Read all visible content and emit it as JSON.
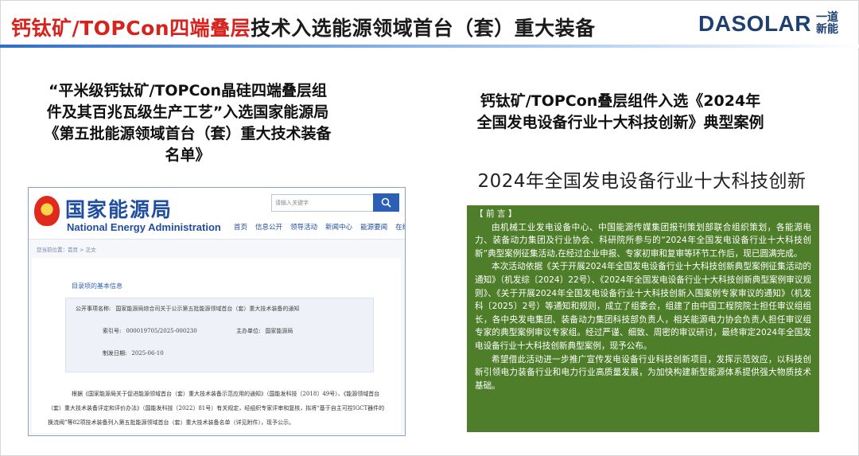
{
  "header": {
    "title_highlight": "钙钛矿/TOPCon四端叠层",
    "title_rest": "技术入选能源领域首台（套）重大装备",
    "logo_text": "DASOLAR",
    "logo_cn_line1": "一道",
    "logo_cn_line2": "新能"
  },
  "left_caption": "“平米级钙钛矿/TOPCon晶硅四端叠层组件及其百兆瓦级生产工艺”入选国家能源局《第五批能源领域首台（套）重大技术装备名单》",
  "right_caption": "钙钛矿/TOPCon叠层组件入选《2024年全国发电设备行业十大科技创新》典型案例",
  "nea_site": {
    "name_cn": "国家能源局",
    "name_en": "National Energy Administration",
    "search_placeholder": "请输入关键字",
    "search_icon": "search-icon",
    "nav": [
      "首页",
      "信息公开",
      "领导活动",
      "新闻中心",
      "能源要闻",
      "在线办事"
    ],
    "breadcrumb": "您当前位置：首页 > 正文",
    "info_title": "目录项的基本信息",
    "info_rows": {
      "public_item_label": "公开事项名称:",
      "public_item_value": "国家能源局综合司关于公示第五批能源领域首台（套）重大技术装备的通知",
      "index_label": "索引号:",
      "index_value": "000019705/2025-000230",
      "issuer_label": "主办单位:",
      "issuer_value": "国家能源局",
      "date_label": "制发日期:",
      "date_value": "2025-06-10"
    },
    "paragraph": "根据《国家能源局关于促进能源领域首台（套）重大技术装备示范应用的通知》（国能发科技〔2018〕49号）、《能源领域首台（套）重大技术装备评定和评价办法》（国能发科技〔2022〕81号）有关规定，经组织专家评审和复核，拟将“基于自主可控IGCT器件的换流阀”等82项技术装备列入第五批能源领域首台（套）重大技术装备名单（详见附件），现予公示。"
  },
  "award": {
    "heading": "2024年全国发电设备行业十大科技创新",
    "notice_label": "【 前 言 】",
    "paragraphs": [
      "由机械工业发电设备中心、中国能源传媒集团报刊策划部联合组织策划，各能源电力、装备动力集团及行业协会、科研院所参与的“2024年全国发电设备行业十大科技创新”典型案例征集活动,在经过企业申报、专家初审和复审等环节工作后，现已圆满完成。",
      "本次活动依据《关于开展2024年全国发电设备行业十大科技创新典型案例征集活动的通知》（机发综〔2024〕22号）、《2024年全国发电设备行业十大科技创新典型案例审议规则》、《关于开展2024年全国发电设备行业十大科技创新入围案例专家审议的通知》（机发科〔2025〕2号）等通知和规则，成立了组委会，组建了由中国工程院院士担任审议组组长，各中央发电集团、装备动力集团科技部负责人，相关能源电力协会负责人担任审议组专家的典型案例审议专家组。经过严谨、细致、周密的审议研讨，最终审定2024年全国发电设备行业十大科技创新典型案例，现予公布。",
      "希望借此活动进一步推广宣传发电设备行业科技创新项目，发挥示范效应，以科技创新引领电力装备行业和电力行业高质量发展，为加快构建新型能源体系提供强大物质技术基础。"
    ]
  },
  "colors": {
    "title_red": "#d7231e",
    "brand_blue": "#1d3f74",
    "notice_green": "#4f7e2a",
    "nea_blue": "#1f4da0"
  }
}
